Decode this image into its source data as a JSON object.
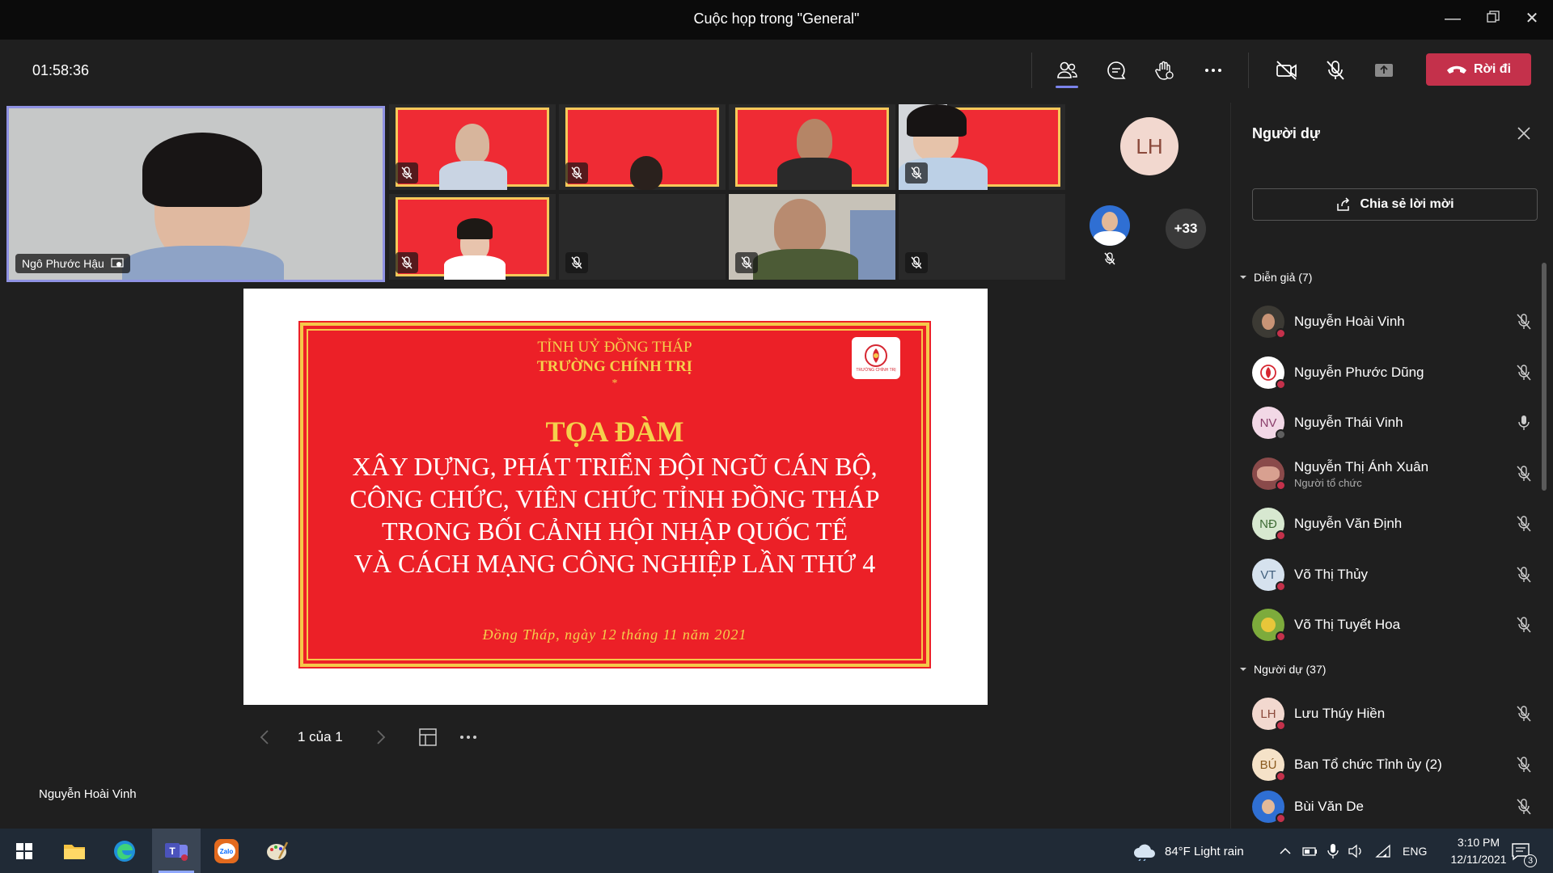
{
  "window": {
    "title": "Cuộc họp trong \"General\""
  },
  "toolbar": {
    "timer": "01:58:36",
    "leave_label": "Rời đi"
  },
  "stage": {
    "main_tile_name": "Ngô Phước Hậu",
    "avatar_lh": "LH",
    "overflow_count": "+33",
    "presenter_name": "Nguyễn Hoài Vinh"
  },
  "slide": {
    "line1": "TỈNH UỶ ĐỒNG THÁP",
    "line2": "TRƯỜNG CHÍNH TRỊ",
    "star": "*",
    "heading": "TỌA ĐÀM",
    "body1": "XÂY DỰNG, PHÁT TRIỂN ĐỘI NGŨ CÁN BỘ,",
    "body2": "CÔNG CHỨC, VIÊN CHỨC TỈNH ĐỒNG THÁP",
    "body3": "TRONG BỐI CẢNH HỘI NHẬP QUỐC TẾ",
    "body4": "VÀ CÁCH MẠNG CÔNG NGHIỆP LẦN THỨ 4",
    "date": "Đồng Tháp, ngày 12 tháng 11 năm 2021",
    "logo_text": "TRƯỜNG CHÍNH TRỊ"
  },
  "pager": {
    "label": "1 của 1"
  },
  "panel": {
    "title": "Người dự",
    "share_label": "Chia sẻ lời mời",
    "presenters_header": "Diễn giả (7)",
    "attendees_header": "Người dự (37)",
    "presenters": [
      {
        "name": "Nguyễn Hoài Vinh",
        "initials": "",
        "role": ""
      },
      {
        "name": "Nguyễn Phước Dũng",
        "initials": "",
        "role": ""
      },
      {
        "name": "Nguyễn Thái Vinh",
        "initials": "NV",
        "role": ""
      },
      {
        "name": "Nguyễn Thị Ánh Xuân",
        "initials": "",
        "role": "Người tổ chức"
      },
      {
        "name": "Nguyễn Văn Định",
        "initials": "NĐ",
        "role": ""
      },
      {
        "name": "Võ Thị Thủy",
        "initials": "VT",
        "role": ""
      },
      {
        "name": "Võ Thị Tuyết Hoa",
        "initials": "",
        "role": ""
      }
    ],
    "attendees": [
      {
        "name": "Lưu Thúy Hiền",
        "initials": "LH"
      },
      {
        "name": "Ban Tổ chức Tỉnh ủy (2)",
        "initials": "BÚ"
      },
      {
        "name": "Bùi Văn De",
        "initials": ""
      }
    ]
  },
  "taskbar": {
    "weather": "84°F  Light rain",
    "lang": "ENG",
    "time": "3:10 PM",
    "date": "12/11/2021",
    "notifications": "3"
  },
  "colors": {
    "accent": "#7b83eb",
    "leave": "#c4314b",
    "slide_red": "#ec2027",
    "slide_gold": "#f5c84a"
  }
}
